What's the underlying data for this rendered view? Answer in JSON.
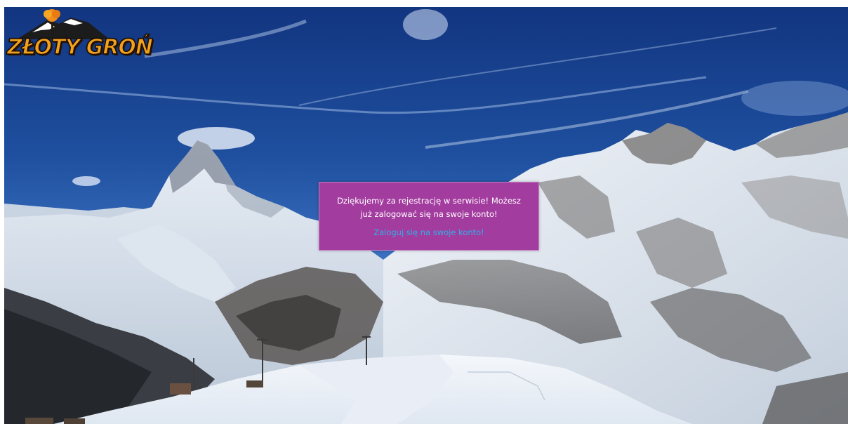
{
  "logo": {
    "text": "ZŁOTY GROŃ",
    "icon": "tree-mountain-logo-icon"
  },
  "dialog": {
    "message": "Dziękujemy za rejestrację w serwisie! Możesz już zalogować się na swoje konto!",
    "login_link": "Zaloguj się na swoje konto!"
  },
  "colors": {
    "dialog_background": "#a33c9f",
    "link": "#2fb1e6",
    "logo_text": "#f2a11d",
    "sky": "#1b3f8f"
  }
}
